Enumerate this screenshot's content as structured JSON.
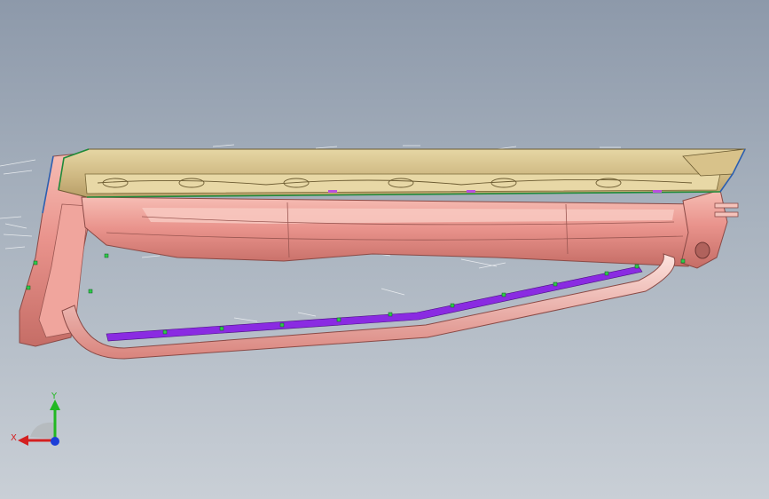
{
  "viewport": {
    "background_top": "#8d99aa",
    "background_bottom": "#c9cfd6"
  },
  "model": {
    "colors": {
      "body_pink": "#e9938c",
      "body_pink_light": "#f4b7ae",
      "body_pink_dark": "#b8605a",
      "top_tan": "#c8b47e",
      "top_tan_light": "#e6d7a4",
      "edge_green": "#1f8a3a",
      "edge_blue": "#2c5fb0",
      "rail_purple": "#8a2be2",
      "marker_green": "#2ec94a",
      "annotation_white": "#f2f4f6"
    }
  },
  "triad": {
    "x_label": "X",
    "y_label": "Y",
    "x_color": "#d42020",
    "y_color": "#22b822",
    "z_color": "#1c3fd8"
  }
}
